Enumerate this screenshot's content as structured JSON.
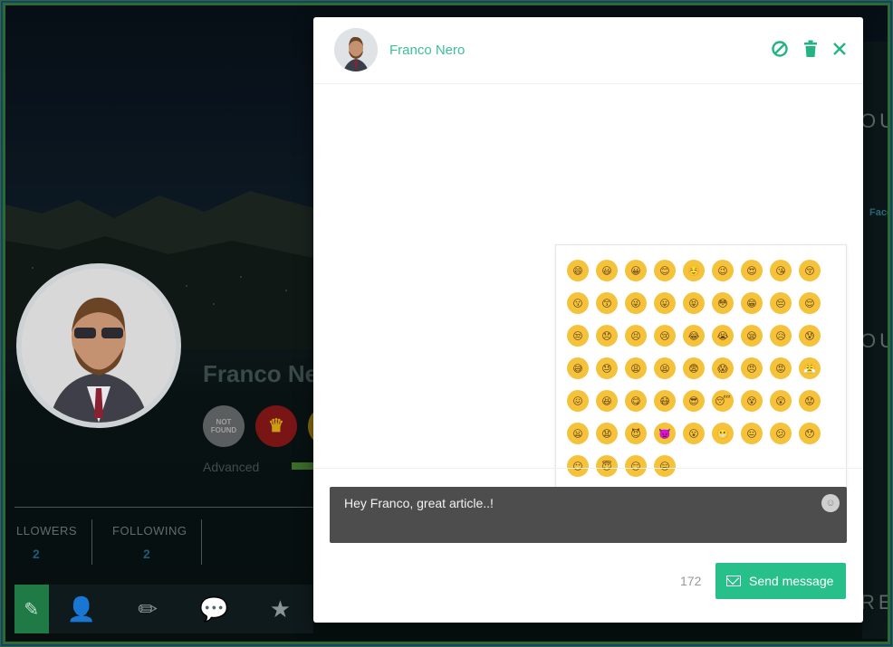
{
  "modal": {
    "contact_name": "Franco Nero",
    "header_icons": [
      "block-icon",
      "trash-icon",
      "close-icon"
    ],
    "message_text": "Hey Franco, great article..!",
    "char_counter": "172",
    "send_label": "Send message",
    "accent_color": "#27c08a"
  },
  "emoji_picker": {
    "emojis": [
      "😄",
      "😃",
      "😀",
      "😊",
      "☺️",
      "😉",
      "😍",
      "😘",
      "😚",
      "😗",
      "😙",
      "😜",
      "😛",
      "😝",
      "😳",
      "😁",
      "😔",
      "😌",
      "😒",
      "😞",
      "😣",
      "😢",
      "😂",
      "😭",
      "😪",
      "😥",
      "😰",
      "😅",
      "😓",
      "😩",
      "😫",
      "😨",
      "😱",
      "😠",
      "😡",
      "😤",
      "😖",
      "😆",
      "😋",
      "😷",
      "😎",
      "😴",
      "😵",
      "😲",
      "😟",
      "😦",
      "😧",
      "😈",
      "👿",
      "😮",
      "😬",
      "😐",
      "😕",
      "😯",
      "😶",
      "😇",
      "😏",
      "😑"
    ]
  },
  "background": {
    "profile_name": "Franco Ne",
    "badge_nf": "NOT FOUND",
    "level_label": "Advanced",
    "stats": [
      {
        "label": "LLOWERS",
        "value": "2"
      },
      {
        "label": "FOLLOWING",
        "value": "2"
      }
    ],
    "right_labels": [
      "OU",
      "OU",
      "REN"
    ],
    "right_small": [
      "Face"
    ]
  }
}
